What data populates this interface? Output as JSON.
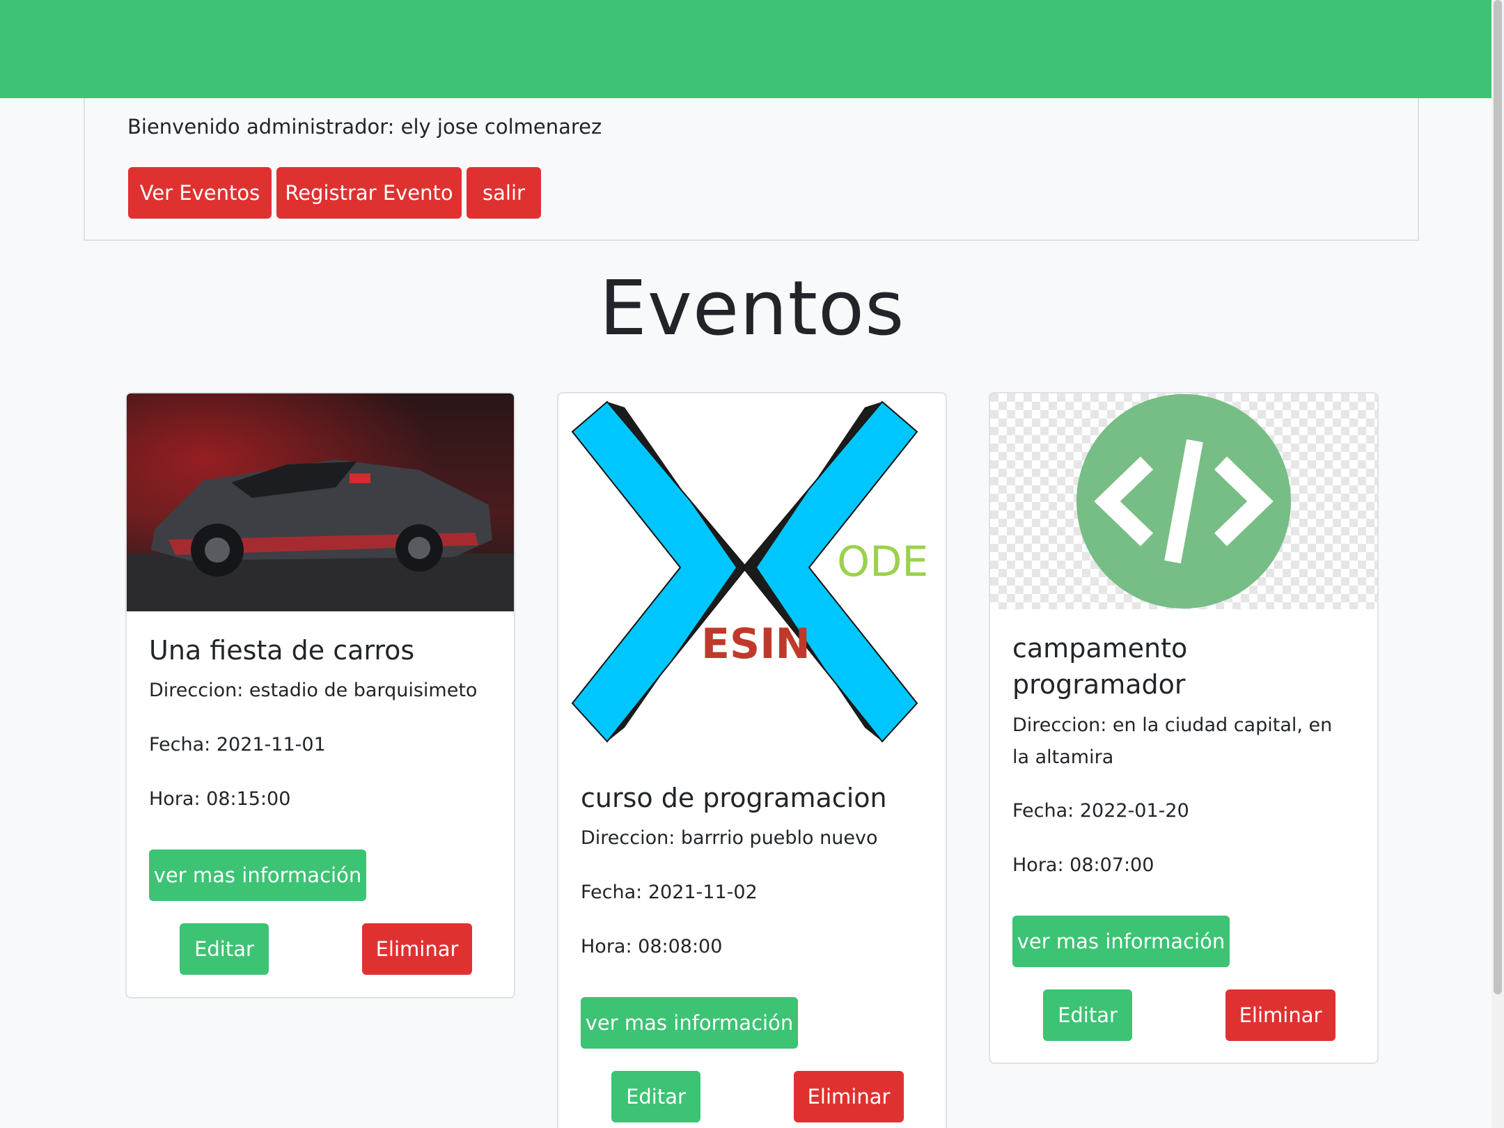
{
  "header": {
    "bg_color": "#3cc374"
  },
  "admin": {
    "welcome": "Bienvenido administrador: ely jose colmenarez",
    "buttons": {
      "ver_eventos": "Ver Eventos",
      "registrar": "Registrar Evento",
      "salir": "salir"
    }
  },
  "page": {
    "title": "Eventos"
  },
  "colors": {
    "accent": "#3cc374",
    "danger": "#e03131"
  },
  "events": [
    {
      "title": "Una fiesta de carros",
      "direccion": "Direccion: estadio de barquisimeto",
      "fecha": "Fecha: 2021-11-01",
      "hora": "Hora: 08:15:00",
      "info_label": "ver mas información",
      "edit_label": "Editar",
      "delete_label": "Eliminar",
      "image": "sports-car-photo"
    },
    {
      "title": "curso de programacion",
      "direccion": "Direccion: barrrio pueblo nuevo",
      "fecha": "Fecha: 2021-11-02",
      "hora": "Hora: 08:08:00",
      "info_label": "ver mas información",
      "edit_label": "Editar",
      "delete_label": "Eliminar",
      "image": "designcode-logo",
      "logo_text": {
        "top": "ODE",
        "bottom": "ESIN"
      }
    },
    {
      "title": "campamento programador",
      "direccion": "Direccion: en la ciudad capital, en la altamira",
      "fecha": "Fecha: 2022-01-20",
      "hora": "Hora: 08:07:00",
      "info_label": "ver mas información",
      "edit_label": "Editar",
      "delete_label": "Eliminar",
      "image": "code-icon-circle"
    }
  ]
}
